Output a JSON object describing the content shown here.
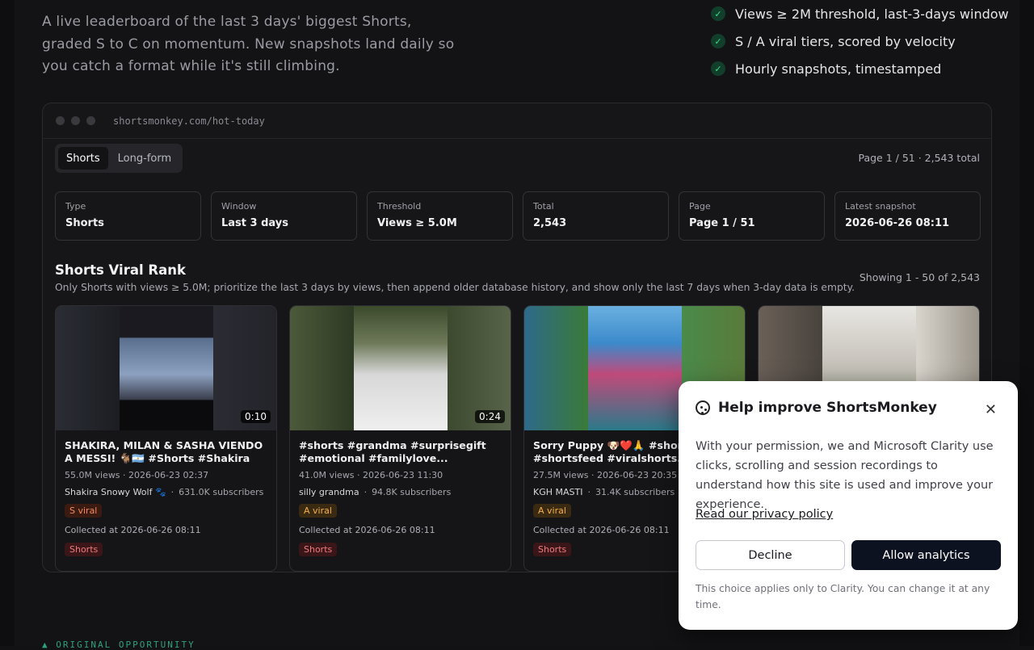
{
  "intro": "A live leaderboard of the last 3 days' biggest Shorts, graded S to C on momentum. New snapshots land daily so you catch a format while it's still climbing.",
  "features": [
    "Views ≥ 2M threshold, last-3-days window",
    "S / A viral tiers, scored by velocity",
    "Hourly snapshots, timestamped"
  ],
  "browser": {
    "url": "shortsmonkey.com/hot-today",
    "tabs": [
      "Shorts",
      "Long-form"
    ],
    "page_info": "Page 1 / 51 · 2,543 total",
    "stats": [
      {
        "label": "Type",
        "value": "Shorts"
      },
      {
        "label": "Window",
        "value": "Last 3 days"
      },
      {
        "label": "Threshold",
        "value": "Views ≥ 5.0M"
      },
      {
        "label": "Total",
        "value": "2,543"
      },
      {
        "label": "Page",
        "value": "Page 1 / 51"
      },
      {
        "label": "Latest snapshot",
        "value": "2026-06-26 08:11"
      }
    ],
    "section_title": "Shorts Viral Rank",
    "section_subtitle": "Only Shorts with views ≥ 5.0M; prioritize the last 3 days by views, then append older database history, and show only the last 7 days when 3-day data is empty.",
    "showing": "Showing 1 - 50 of 2,543",
    "cards": [
      {
        "duration": "0:10",
        "title": "SHAKIRA, MILAN & SASHA VIENDO A MESSI! 🐐🇦🇷 #Shorts #Shakira",
        "meta": "55.0M views · 2026-06-23 02:37",
        "channel": "Shakira Snowy Wolf 🐾",
        "subs": "631.0K subscribers",
        "tier": "S viral",
        "collected": "Collected at 2026-06-26 08:11",
        "tag": "Shorts"
      },
      {
        "duration": "0:24",
        "title": "#shorts #grandma #surprisegift #emotional #familylove...",
        "meta": "41.0M views · 2026-06-23 11:30",
        "channel": "silly grandma",
        "subs": "94.8K subscribers",
        "tier": "A viral",
        "collected": "Collected at 2026-06-26 08:11",
        "tag": "Shorts"
      },
      {
        "duration": "",
        "title": "Sorry Puppy 🐶❤️🙏 #shorts #shortsfeed #viralshorts...",
        "meta": "27.5M views · 2026-06-23 20:35",
        "channel": "KGH MASTI",
        "subs": "31.4K subscribers",
        "tier": "A viral",
        "collected": "Collected at 2026-06-26 08:11",
        "tag": "Shorts"
      },
      {
        "duration": "",
        "title": "",
        "meta": "",
        "channel": "",
        "subs": "",
        "tier": "",
        "collected": "",
        "tag": ""
      }
    ]
  },
  "original_label": "▲ ORIGINAL OPPORTUNITY",
  "consent": {
    "title": "Help improve ShortsMonkey",
    "body": "With your permission, we and Microsoft Clarity use clicks, scrolling and session recordings to understand how this site is used and improve your experience.",
    "link": "Read our privacy policy",
    "decline": "Decline",
    "allow": "Allow analytics",
    "note": "This choice applies only to Clarity. You can change it at any time."
  }
}
